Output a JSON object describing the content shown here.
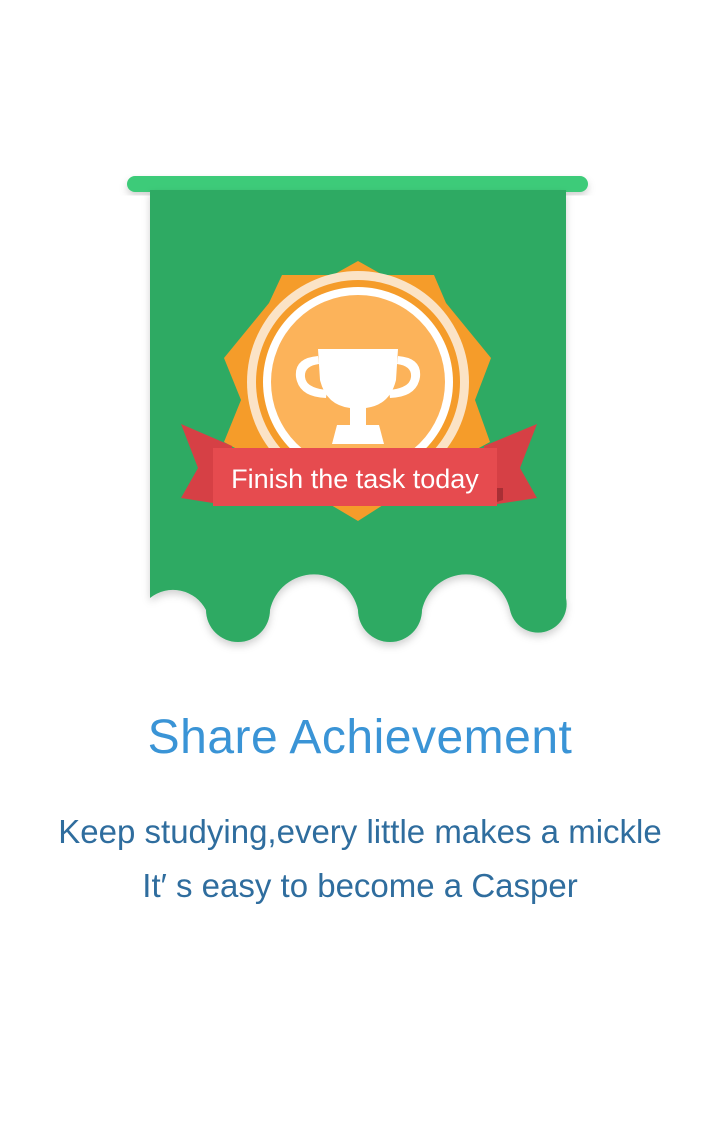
{
  "badge": {
    "ribbon_text": "Finish the task today",
    "icon": "trophy-icon"
  },
  "intro": {
    "title": "Share Achievement",
    "line1": "Keep studying,every little makes a mickle",
    "line2": "It′ s easy to become a Casper"
  },
  "colors": {
    "banner_green": "#2eaa63",
    "rod_green": "#3dcb79",
    "badge_orange": "#f59c2a",
    "ribbon_red": "#e64b4f",
    "title_blue": "#3a94d6",
    "text_blue": "#2f6d9e"
  }
}
